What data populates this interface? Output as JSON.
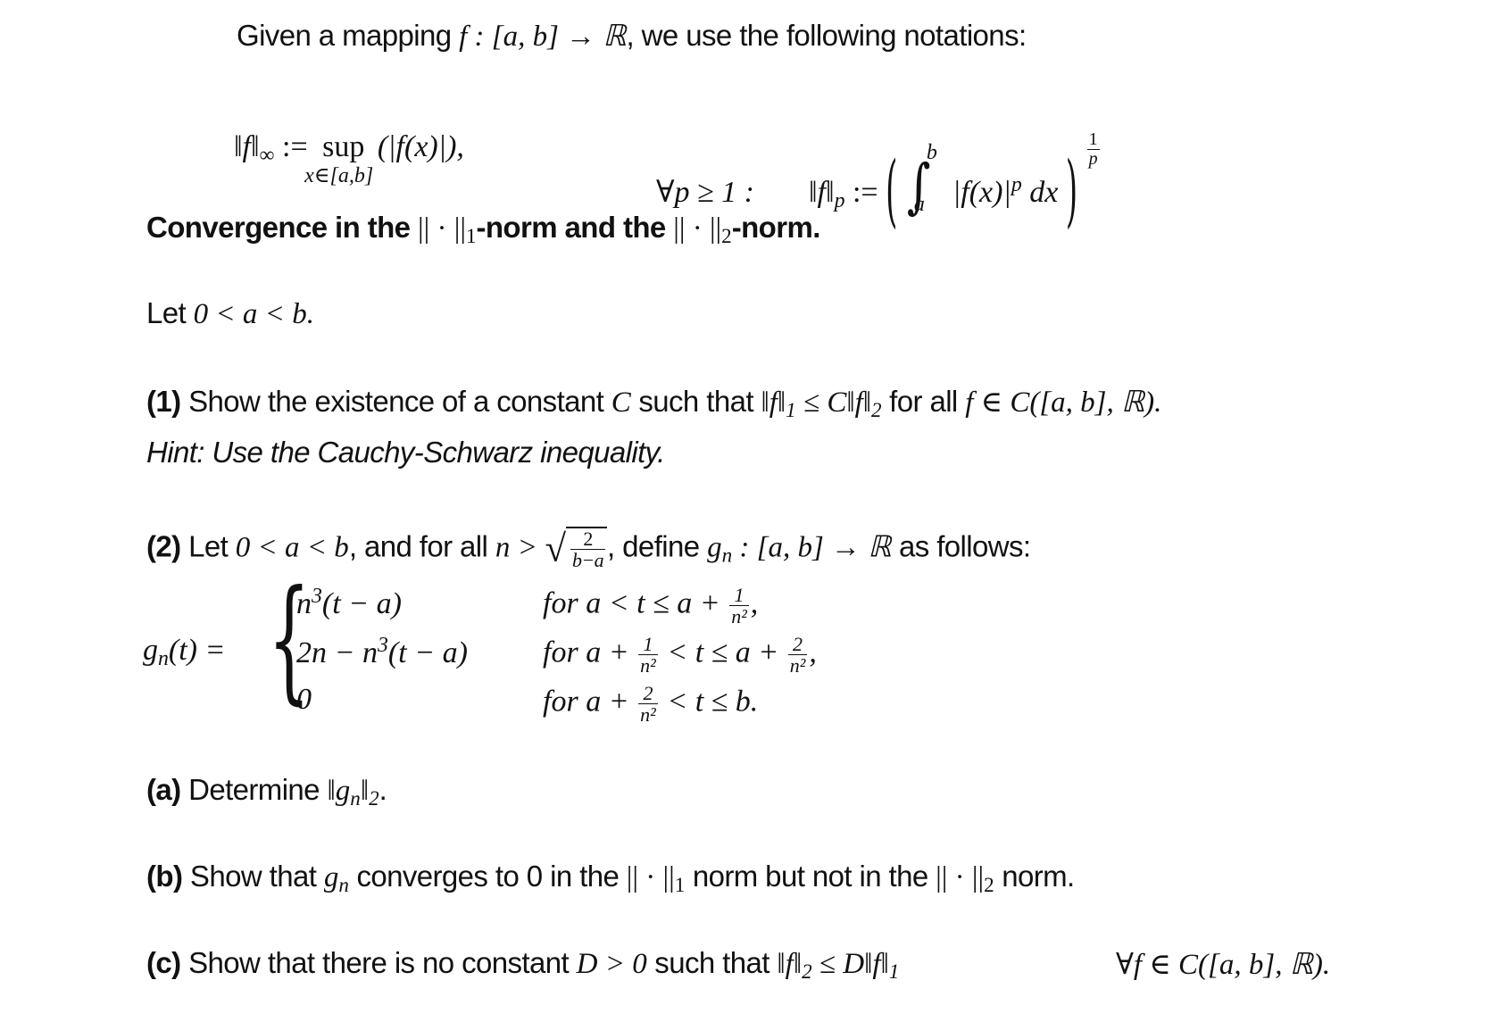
{
  "intro": {
    "text_before": "Given a mapping ",
    "math_map": "f : [a, b] → ℝ",
    "text_after": ", we use the following notations:"
  },
  "definitions": {
    "inf_norm_lhs": "‖f‖",
    "inf_sub": "∞",
    "assign": ":=",
    "sup": "sup",
    "sup_sub": "x∈[a,b]",
    "sup_arg": "(|f(x)|),",
    "forall_p": "∀p ≥ 1 :",
    "p_norm_lhs": "‖f‖",
    "p_sub": "p",
    "integral_upper": "b",
    "integral_lower": "a",
    "integrand": "|f(x)|",
    "integrand_exp": "p",
    "dx": "dx",
    "outer_exp_num": "1",
    "outer_exp_den": "p"
  },
  "heading": {
    "part1": "Convergence in the ",
    "norm1": "|| · ||",
    "sub1": "1",
    "part2": "-norm and the ",
    "norm2": "|| · ||",
    "sub2": "2",
    "part3": "-norm."
  },
  "let": {
    "text": "Let ",
    "math": "0 < a < b."
  },
  "q1": {
    "label": "(1)",
    "text1": " Show the existence of a constant ",
    "C": "C",
    "text2": " such that ",
    "ineq_a": "‖f‖",
    "ineq_sub1": "1",
    "ineq_b": " ≤ C‖f‖",
    "ineq_sub2": "2",
    "text3": " for all ",
    "set": "f ∈ C([a, b], ℝ).",
    "hint": "Hint: Use the Cauchy-Schwarz inequality."
  },
  "q2": {
    "label": "(2)",
    "text1": " Let ",
    "cond": "0 < a < b",
    "text2": ", and for all ",
    "n_gt": "n >",
    "sqrt_num": "2",
    "sqrt_den": "b−a",
    "text3": ", define ",
    "g": "g",
    "g_sub": "n",
    "map": " : [a, b] → ℝ",
    "text4": " as follows:",
    "lhs": "g",
    "lhs_sub": "n",
    "lhs_rest": "(t) =",
    "cases": [
      {
        "expr_pre": "n",
        "expr_sup": "3",
        "expr_post": "(t − a)",
        "cond_pre": "for ",
        "cond_mid": "a < t ≤ a + ",
        "frac_num": "1",
        "frac_den": "n²",
        "cond_post": ",",
        "cond_mid2": "",
        "frac2_num": "",
        "frac2_den": ""
      },
      {
        "expr_pre": "2n − n",
        "expr_sup": "3",
        "expr_post": "(t − a)",
        "cond_pre": "for ",
        "cond_mid": "a + ",
        "frac_num": "1",
        "frac_den": "n²",
        "cond_mid2": " < t ≤ a + ",
        "frac2_num": "2",
        "frac2_den": "n²",
        "cond_post": ","
      },
      {
        "expr_pre": "0",
        "expr_sup": "",
        "expr_post": "",
        "cond_pre": "for ",
        "cond_mid": "a + ",
        "frac_num": "2",
        "frac_den": "n²",
        "cond_mid2": " < t ≤ b.",
        "frac2_num": "",
        "frac2_den": "",
        "cond_post": ""
      }
    ]
  },
  "qa": {
    "label": "(a)",
    "text": " Determine ",
    "math": "‖g",
    "math_sub": "n",
    "math2": "‖",
    "math_sub2": "2",
    "end": "."
  },
  "qb": {
    "label": "(b)",
    "text1": " Show that ",
    "g": "g",
    "g_sub": "n",
    "text2": " converges to 0 in the ",
    "norm1": "|| · ||",
    "sub1": "1",
    "text3": " norm but not in the ",
    "norm2": "|| · ||",
    "sub2": "2",
    "text4": " norm."
  },
  "qc": {
    "label": "(c)",
    "text1": " Show that there is no constant ",
    "math1": "D > 0",
    "text2": " such that ",
    "ineq_a": "‖f‖",
    "ineq_sub1": "2",
    "ineq_b": " ≤ D‖f‖",
    "ineq_sub2": "1",
    "forall": "∀f ∈ C([a, b], ℝ)."
  }
}
